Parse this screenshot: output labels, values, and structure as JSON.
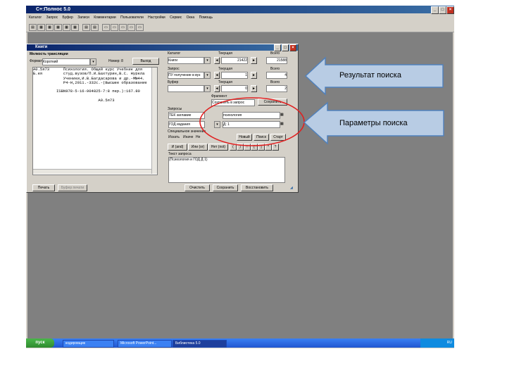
{
  "app": {
    "title": "С+:Полнос 5.0",
    "menu": [
      "Каталог",
      "Запрос",
      "Буфер",
      "Записи",
      "Комментарии",
      "Пользователи",
      "Настройки",
      "Сервис",
      "Окна",
      "Помощь"
    ]
  },
  "window": {
    "title": "Книги",
    "header_label": "Мелкость трансляции",
    "format_label": "Формат",
    "format_value": "Короткий",
    "number_label": "Номер: 8",
    "exit_button": "Выход",
    "result_text": "А0.5я73      Психология. Общий курс Учебник для\nБ.ея         студ.вузов/П.И.Бахтурин,В.С. Нуркла\n             Ученики,И.В.Багдасарова и др.-М№44.\n             Р4-Н,2011.-332с.-(Высшее образование\n\n          ISBN978-5-16-004825-7:8 пер.):167.80\n\n                            А0.5я73",
    "print_button": "Печать",
    "buffer_button": "Буфер печати",
    "catalog_label": "Каталог",
    "catalog_value": "Книги",
    "current_label": "Текущая",
    "current_catalog": "21422",
    "total_label": "Всего",
    "total_catalog": "21588",
    "query_label": "Запрос",
    "query_value": "ПУ получение в вуз",
    "current_query": "1",
    "total_query": "4",
    "buffer_label": "Буфер",
    "buffer_value": "",
    "current_buffer": "0",
    "total_buffer": "2",
    "fragment_label": "Фрагмент",
    "fragment_value": "Сохранить в запрос",
    "save_button": "Сохранить",
    "search_fields_label": "Запросы",
    "search_field_1": "ТЕК заглавие",
    "search_value_1": "психология",
    "search_field_2": "ГОД издания",
    "search_value_2": "Д: 1",
    "scope_label": "Специальное значение",
    "scope_options": [
      "Искать",
      "Иначе",
      "Не"
    ],
    "clear_button": "Новый",
    "search_button": "Поиск",
    "stop_button": "Старт",
    "logic_buttons": [
      "И (and)",
      "Или (or)",
      "Нет (not)"
    ],
    "query_text_label": "Текст запроса",
    "query_text": "(Психология и ГОД Д 1)",
    "reset_button": "Очистить",
    "save_query_button": "Сохранить",
    "restore_button": "Восстановить"
  },
  "callouts": {
    "result": "Результат поиска",
    "params": "Параметры поиска"
  },
  "taskbar": {
    "start": "пуск",
    "tasks": [
      "кодировщик",
      "Microsoft PowerPoint...",
      "Библиотека 5.0"
    ],
    "tray": "RU"
  }
}
